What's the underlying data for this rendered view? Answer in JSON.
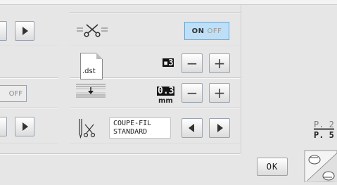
{
  "screen": {
    "left_column": {
      "off_label": "OFF"
    },
    "thread_cutter": {
      "icon": "scissors-icon",
      "toggle": {
        "on_label": "ON",
        "off_label": "OFF",
        "selected": "ON"
      },
      "accent": "#bde0f8"
    },
    "file_format": {
      "file_label": ".dst",
      "value": "▪3",
      "minus_label": "−",
      "plus_label": "+"
    },
    "jump_stitch": {
      "value": "0.3",
      "unit": "mm",
      "minus_label": "−",
      "plus_label": "+"
    },
    "thread_cut_mode": {
      "label": "COUPE-FIL\nSTANDARD"
    },
    "ok_label": "OK",
    "page": {
      "current": "P. 2",
      "total": "P. 5"
    }
  }
}
